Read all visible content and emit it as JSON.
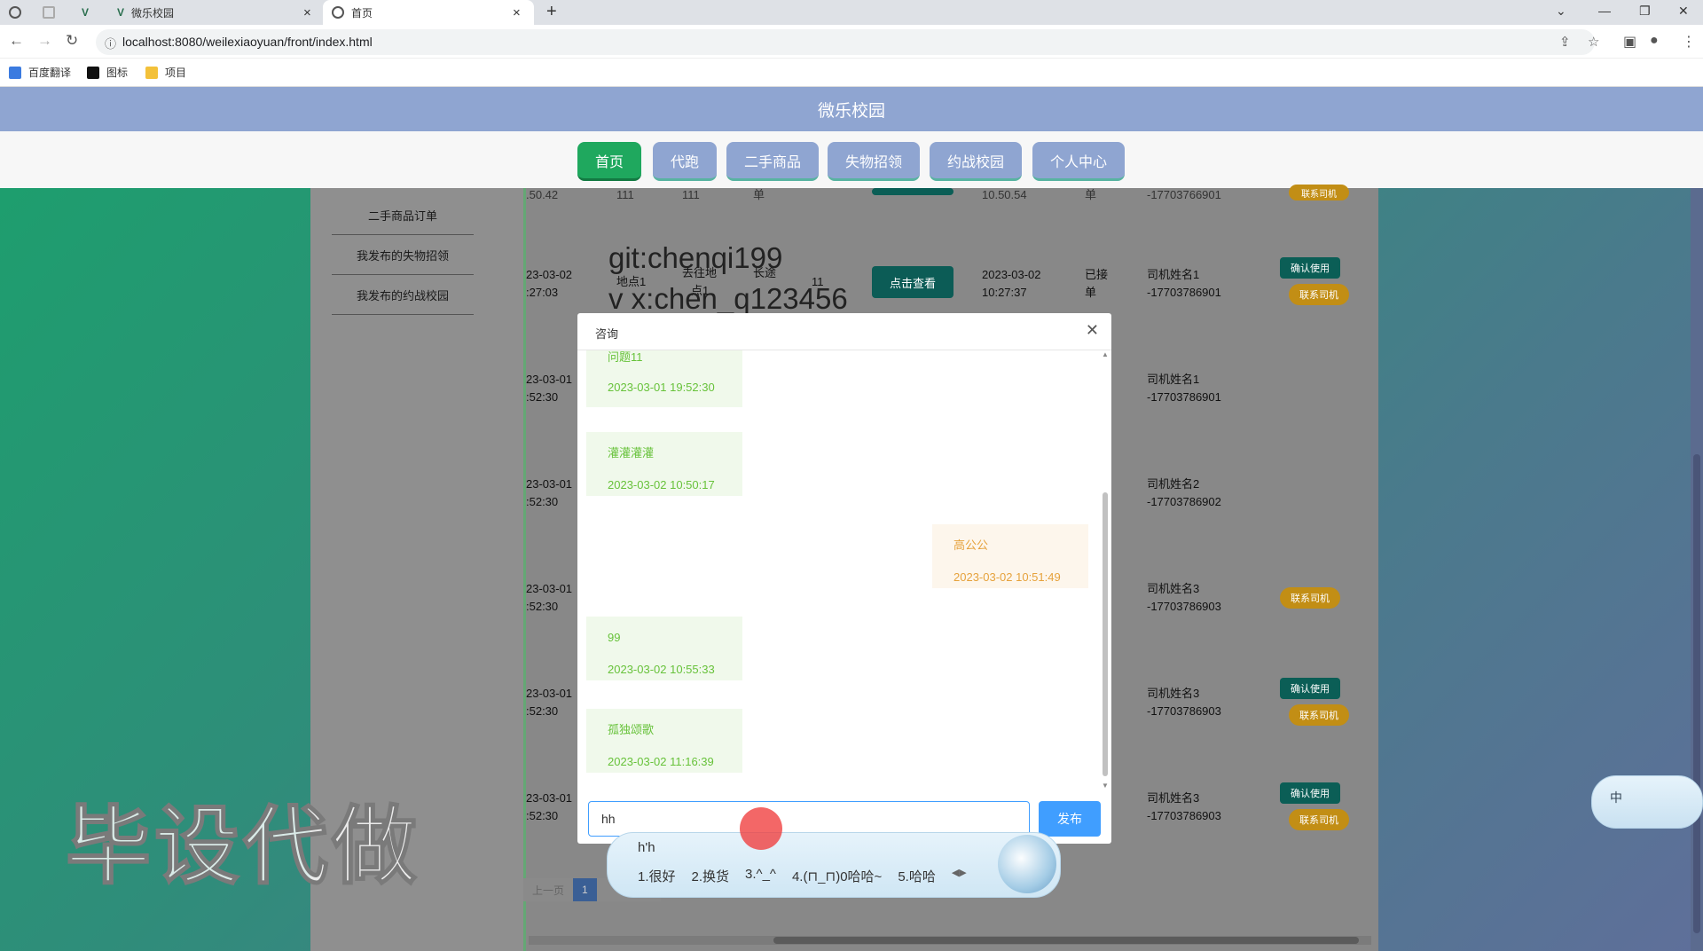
{
  "browser": {
    "tabs": [
      {
        "title": ""
      },
      {
        "title": ""
      },
      {
        "title": ""
      },
      {
        "title": "微乐校园"
      },
      {
        "title": "首页"
      }
    ],
    "new_tab": "+",
    "url": "localhost:8080/weilexiaoyuan/front/index.html",
    "bookmarks": [
      "百度翻译",
      "图标",
      "项目"
    ]
  },
  "site": {
    "title": "微乐校园",
    "nav": [
      "首页",
      "代跑",
      "二手商品",
      "失物招领",
      "约战校园",
      "个人中心"
    ],
    "active_nav": "首页"
  },
  "sidebar": {
    "items": [
      "二手商品订单",
      "我发布的失物招领",
      "我发布的约战校园"
    ]
  },
  "table": {
    "rows": [
      {
        "time_a": "23-03-02",
        "time_b": ":27:03",
        "from": "地点1",
        "dest": "去往地",
        "dest2": "点1",
        "kind": "长途",
        "num": "11",
        "view": "点击查看",
        "acc_date": "2023-03-02",
        "acc_time": "10:27:37",
        "status_a": "已接",
        "status_b": "单",
        "driver": "司机姓名1",
        "phone": "-17703786901",
        "confirm": "确认使用",
        "contact": "联系司机"
      },
      {
        "time_a": "23-03-01",
        "time_b": ":52:30",
        "driver": "司机姓名1",
        "phone": "-17703786901"
      },
      {
        "time_a": "23-03-01",
        "time_b": ":52:30",
        "driver": "司机姓名2",
        "phone": "-17703786902"
      },
      {
        "time_a": "23-03-01",
        "time_b": ":52:30",
        "driver": "司机姓名3",
        "phone": "-17703786903",
        "contact": "联系司机"
      },
      {
        "time_a": "23-03-01",
        "time_b": ":52:30",
        "driver": "司机姓名3",
        "phone": "-17703786903",
        "confirm": "确认使用",
        "contact": "联系司机"
      },
      {
        "time_a": "23-03-01",
        "time_b": ":52:30",
        "driver": "司机姓名3",
        "phone": "-17703786903",
        "confirm": "确认使用",
        "contact": "联系司机"
      }
    ],
    "top_partial": {
      "time": ".50.42",
      "v1": "111",
      "v2": "111",
      "v3": "单",
      "acc_time": "10.50.54",
      "v4": "单",
      "phone": "-17703766901",
      "contact": "联系司机"
    },
    "pager": {
      "prev": "上一页",
      "current": "1"
    }
  },
  "watermark": {
    "line1": "git:chenqi199",
    "line2": "v x:chen_q123456"
  },
  "dialog": {
    "title": "咨询",
    "messages": [
      {
        "side": "left",
        "text": "问题11",
        "time": "2023-03-01 19:52:30"
      },
      {
        "side": "left",
        "text": "灌灌灌灌",
        "time": "2023-03-02 10:50:17"
      },
      {
        "side": "right",
        "text": "高公公",
        "time": "2023-03-02 10:51:49"
      },
      {
        "side": "left",
        "text": "99",
        "time": "2023-03-02 10:55:33"
      },
      {
        "side": "left",
        "text": "孤独颂歌",
        "time": "2023-03-02 11:16:39"
      }
    ],
    "input_value": "hh",
    "send_label": "发布"
  },
  "ime": {
    "pinyin": "h'h",
    "candidates": [
      "1.很好",
      "2.换货",
      "3.^_^",
      "4.(⊓_⊓)0哈哈~",
      "5.哈哈"
    ],
    "mode": "中"
  },
  "overlay_caption": "毕设代做"
}
